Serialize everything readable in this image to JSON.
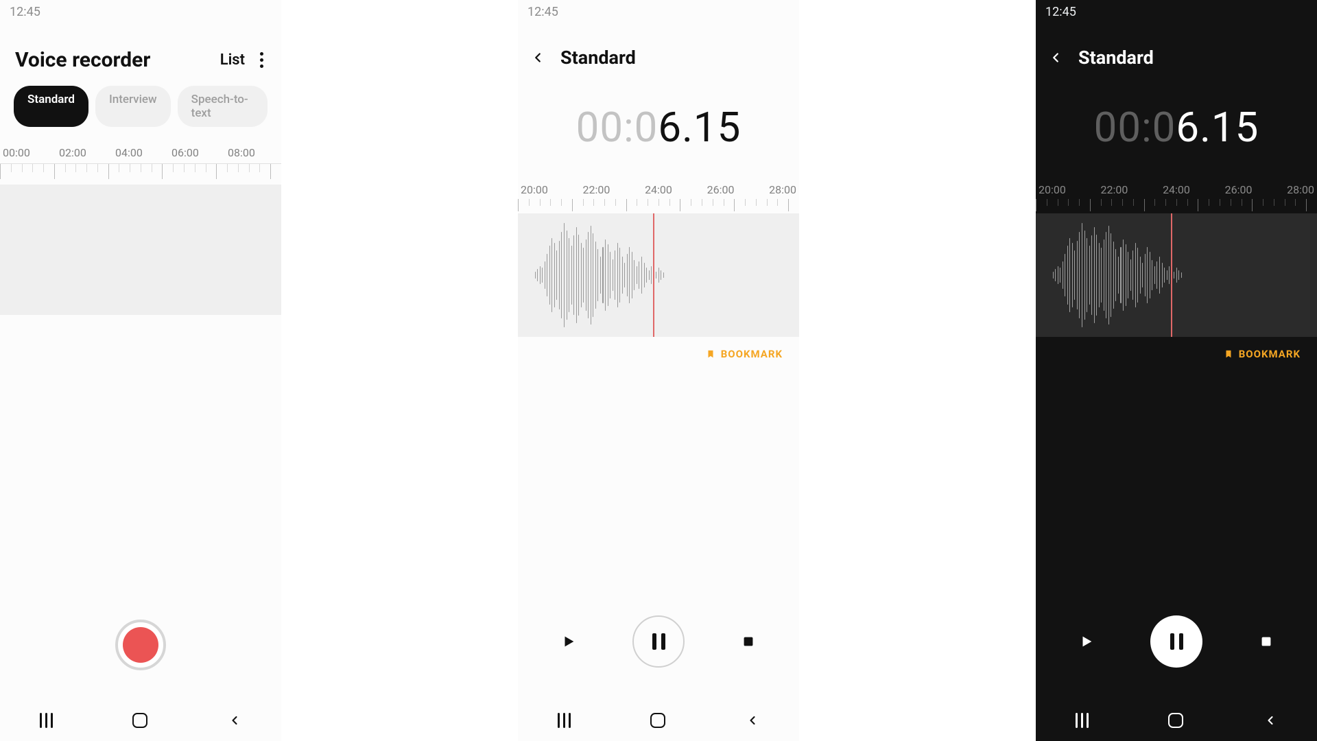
{
  "status_time": "12:45",
  "colors": {
    "accent_record": "#eb5454",
    "accent_bookmark": "#f5a623",
    "playhead": "#e06868"
  },
  "panel1": {
    "title": "Voice recorder",
    "list": "List",
    "pills": [
      "Standard",
      "Interview",
      "Speech-to-text"
    ],
    "ruler": [
      "00:00",
      "02:00",
      "04:00",
      "06:00",
      "08:00"
    ]
  },
  "recording": {
    "header": "Standard",
    "timer_dim": "00:0",
    "timer_bright": "6.15",
    "ruler": [
      "20:00",
      "22:00",
      "24:00",
      "26:00",
      "28:00"
    ],
    "bookmark": "BOOKMARK"
  }
}
